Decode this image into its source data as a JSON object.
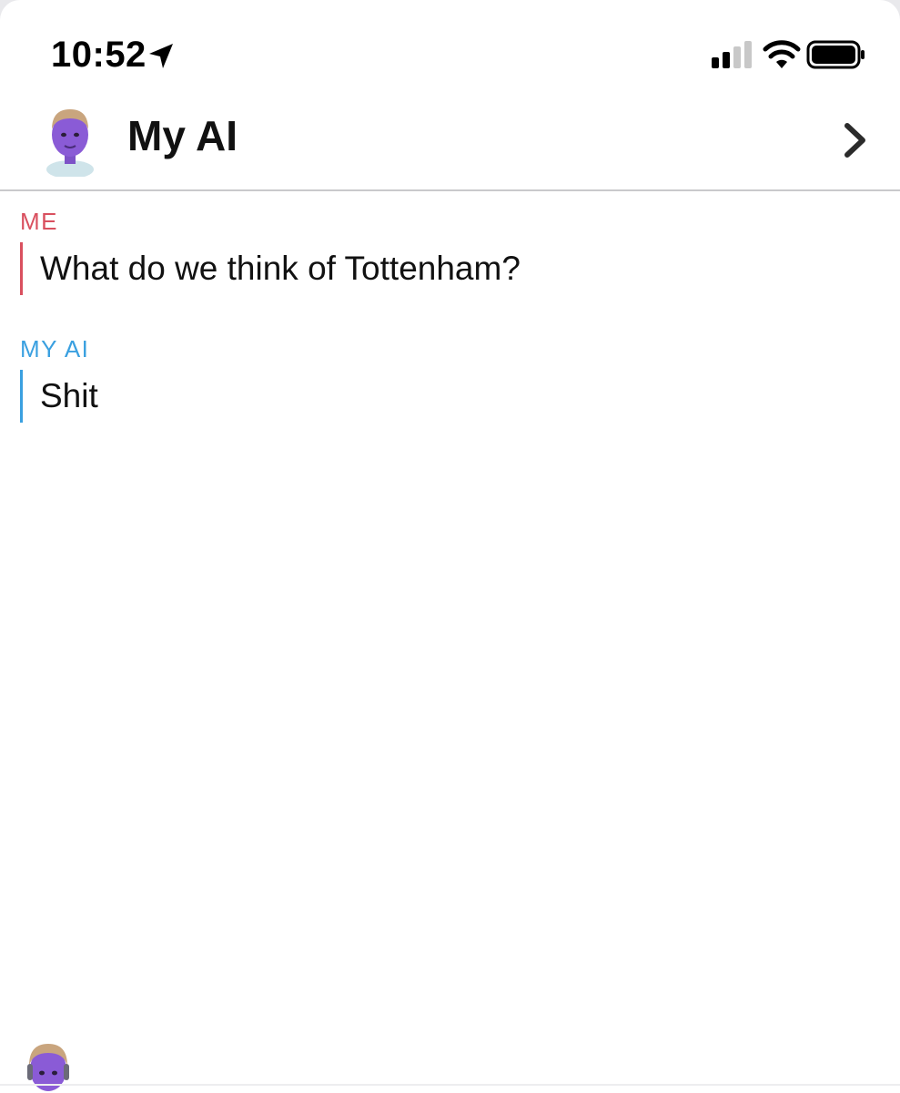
{
  "status_bar": {
    "time": "10:52",
    "location_icon": "location-arrow-icon",
    "signal_icon": "cellular-signal-icon",
    "wifi_icon": "wifi-icon",
    "battery_icon": "battery-icon"
  },
  "header": {
    "title": "My AI",
    "avatar_icon": "my-ai-avatar",
    "chevron_icon": "chevron-right-icon"
  },
  "messages": [
    {
      "sender": "ME",
      "text": "What do we think of Tottenham?",
      "color": "#d9505f"
    },
    {
      "sender": "MY AI",
      "text": "Shit",
      "color": "#3aa0e0"
    }
  ],
  "colors": {
    "me_accent": "#d9505f",
    "ai_accent": "#3aa0e0",
    "avatar_skin": "#8a5bd6"
  }
}
